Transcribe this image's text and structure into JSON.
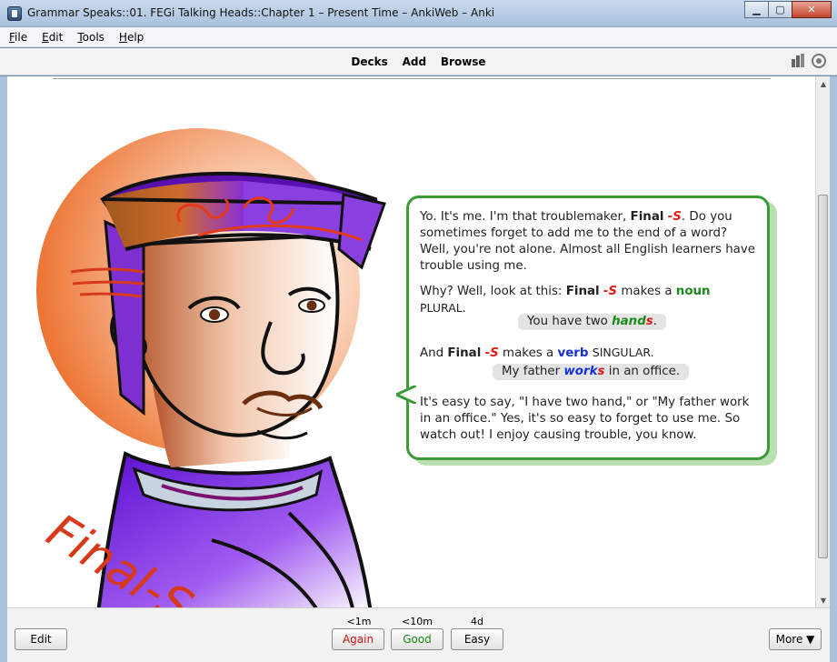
{
  "window": {
    "title": "Grammar Speaks::01. FEGi Talking Heads::Chapter 1  –  Present Time – AnkiWeb – Anki"
  },
  "menu": [
    {
      "label_u": "F",
      "label_rest": "ile"
    },
    {
      "label_u": "E",
      "label_rest": "dit"
    },
    {
      "label_u": "T",
      "label_rest": "ools"
    },
    {
      "label_u": "H",
      "label_rest": "elp"
    }
  ],
  "toolbar": {
    "links": [
      "Decks",
      "Add",
      "Browse"
    ]
  },
  "illustration": {
    "signature": "Final-S"
  },
  "bubble": {
    "p1_a": "Yo. It's me. I'm that troublemaker, ",
    "final": "Final",
    "dash_s": "-S",
    "p1_b": ". Do you sometimes forget to add me to the end of a word? Well, you're not alone. Almost all English learners have trouble using me.",
    "p2_a": "Why? Well, look at this: ",
    "p2_b": " makes a ",
    "noun": "noun",
    "plural": "PLURAL.",
    "ex1_a": "You have two ",
    "ex1_word": "hand",
    "ex1_s": "s",
    "ex1_end": ".",
    "p3_a": "And ",
    "p3_b": " makes a ",
    "verb": "verb",
    "singular": "SINGULAR.",
    "ex2_a": "My father ",
    "ex2_word": "work",
    "ex2_s": "s",
    "ex2_end": " in an office.",
    "p4": "It's easy to say, \"I have two hand,\" or \"My father work in an office.\" Yes, it's so easy to forget to use me. So watch out! I enjoy causing trouble, you know."
  },
  "bottom": {
    "edit_label": "Edit",
    "again_time": "<1m",
    "again_label": "Again",
    "good_time": "<10m",
    "good_label": "Good",
    "easy_time": "4d",
    "easy_label": "Easy",
    "more_label": "More ▼"
  },
  "colors": {
    "again": "#d01010",
    "good": "#138a13",
    "bubble_border": "#3a9a35"
  }
}
